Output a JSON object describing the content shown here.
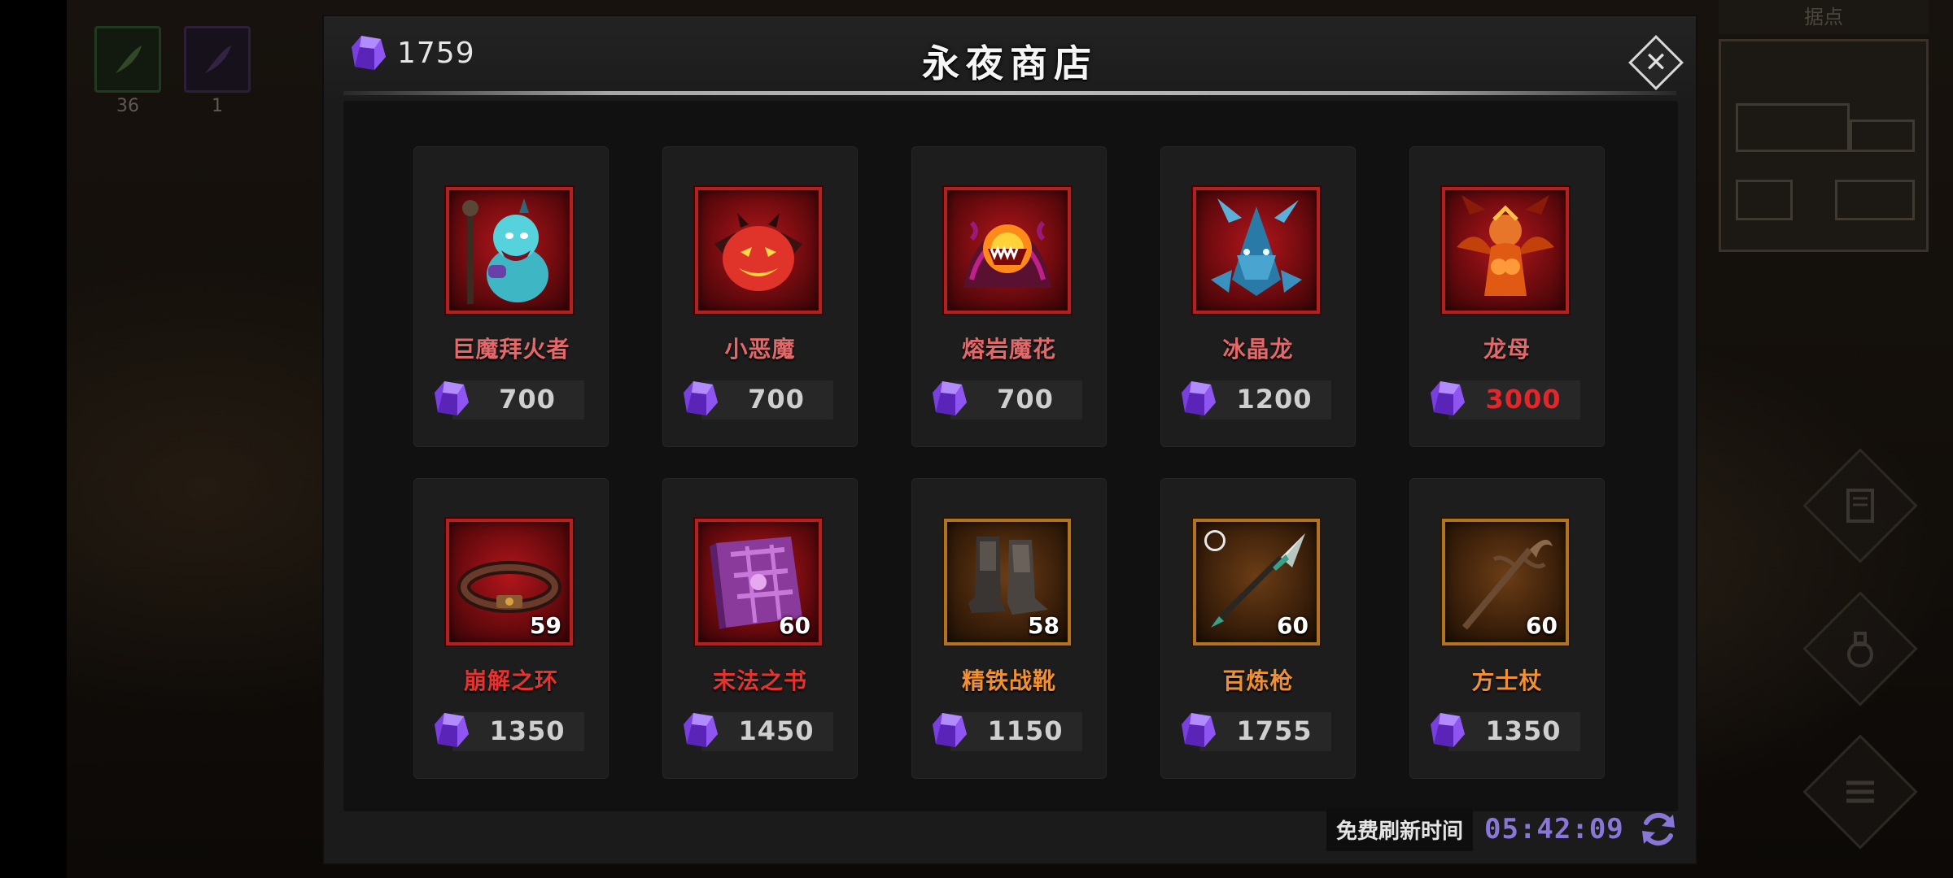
{
  "hud": {
    "minimap_title": "据点",
    "tile_counts": [
      "36",
      "1"
    ]
  },
  "shop": {
    "title": "永夜商店",
    "currency_amount": "1759",
    "close_symbol": "✕",
    "refresh_label": "免费刷新时间",
    "refresh_timer": "05:42:09"
  },
  "items": [
    {
      "name": "巨魔拜火者",
      "price": "700",
      "level": "",
      "rarity": "red",
      "name_color": "#e4686a",
      "price_color": "#cfcfcf",
      "icon": "troll-icon"
    },
    {
      "name": "小恶魔",
      "price": "700",
      "level": "",
      "rarity": "red",
      "name_color": "#e4686a",
      "price_color": "#cfcfcf",
      "icon": "imp-icon"
    },
    {
      "name": "熔岩魔花",
      "price": "700",
      "level": "",
      "rarity": "red",
      "name_color": "#e4686a",
      "price_color": "#cfcfcf",
      "icon": "lava-flower-icon"
    },
    {
      "name": "冰晶龙",
      "price": "1200",
      "level": "",
      "rarity": "red",
      "name_color": "#e4686a",
      "price_color": "#cfcfcf",
      "icon": "ice-dragon-icon"
    },
    {
      "name": "龙母",
      "price": "3000",
      "level": "",
      "rarity": "red",
      "name_color": "#e4686a",
      "price_color": "#e3262a",
      "icon": "dragon-mother-icon"
    },
    {
      "name": "崩解之环",
      "price": "1350",
      "level": "59",
      "rarity": "red",
      "name_color": "#e8322f",
      "price_color": "#cfcfcf",
      "icon": "ring-icon"
    },
    {
      "name": "末法之书",
      "price": "1450",
      "level": "60",
      "rarity": "red",
      "name_color": "#e8322f",
      "price_color": "#cfcfcf",
      "icon": "book-icon"
    },
    {
      "name": "精铁战靴",
      "price": "1150",
      "level": "58",
      "rarity": "gold",
      "name_color": "#f09032",
      "price_color": "#cfcfcf",
      "icon": "boots-icon"
    },
    {
      "name": "百炼枪",
      "price": "1755",
      "level": "60",
      "rarity": "gold",
      "name_color": "#f09032",
      "price_color": "#cfcfcf",
      "icon": "spear-icon"
    },
    {
      "name": "方士杖",
      "price": "1350",
      "level": "60",
      "rarity": "gold",
      "name_color": "#f09032",
      "price_color": "#cfcfcf",
      "icon": "staff-icon"
    }
  ]
}
